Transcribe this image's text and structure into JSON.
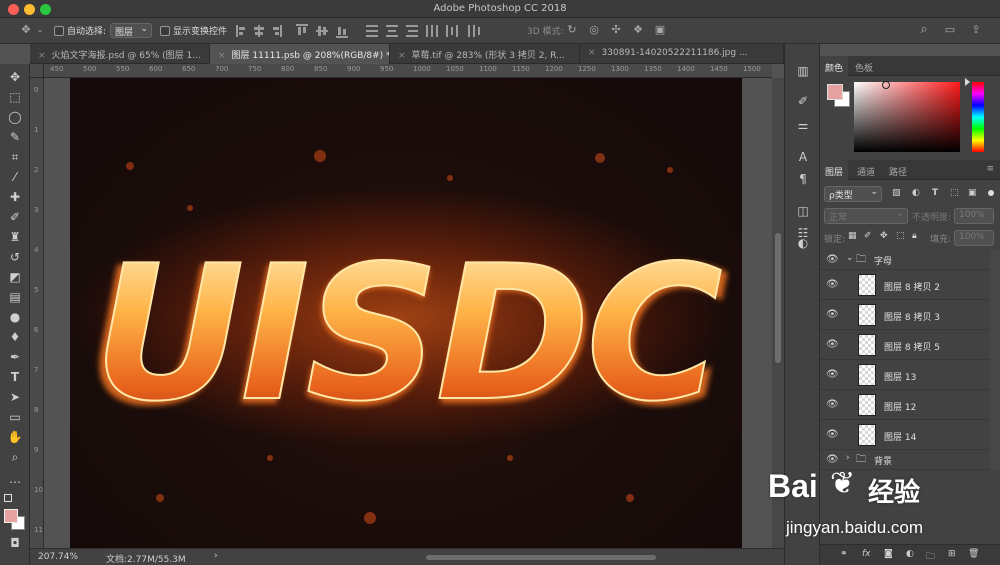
{
  "window": {
    "title": "Adobe Photoshop CC 2018"
  },
  "options_bar": {
    "auto_select_label": "自动选择:",
    "auto_select_value": "图层",
    "show_transform_label": "显示变换控件",
    "mode_3d_label": "3D 模式:"
  },
  "tabs": [
    {
      "label": "火焰文字海报.psd @ 65% (图层 1..."
    },
    {
      "label": "图层 11111.psb @ 208%(RGB/8#) *"
    },
    {
      "label": "草莓.tif @ 283% (形状 3 拷贝 2, R..."
    },
    {
      "label": "330891-14020522211186.jpg ..."
    }
  ],
  "ruler": {
    "horizontal": [
      "450",
      "500",
      "550",
      "600",
      "650",
      "700",
      "750",
      "800",
      "850",
      "900",
      "950",
      "1000",
      "1050",
      "1100",
      "1150",
      "1200",
      "1250",
      "1300",
      "1350",
      "1400",
      "1450",
      "1500"
    ],
    "vertical": [
      "0",
      "1",
      "2",
      "3",
      "4",
      "5",
      "6",
      "7",
      "8",
      "9",
      "10",
      "11"
    ]
  },
  "canvas": {
    "text": "UISDC"
  },
  "status": {
    "zoom": "207.74%",
    "doc": "文档:2.77M/55.3M",
    "arrow": "›"
  },
  "color_panel": {
    "tabs": [
      "颜色",
      "色板"
    ],
    "foreground": "#e4a2a1",
    "background": "#ffffff",
    "hue": "#ff1a1a"
  },
  "layers_panel": {
    "tabs": [
      "图层",
      "通道",
      "路径"
    ],
    "filter_label": "ρ类型",
    "blend_mode": "正常",
    "opacity_label": "不透明度:",
    "opacity_value": "100%",
    "lock_label": "锁定:",
    "fill_label": "填充:",
    "fill_value": "100%",
    "group_label": "字母",
    "layers": [
      {
        "name": "图层 8 拷贝 2"
      },
      {
        "name": "图层 8 拷贝 3"
      },
      {
        "name": "图层 8 拷贝 5"
      },
      {
        "name": "图层 13"
      },
      {
        "name": "图层 12"
      },
      {
        "name": "图层 14"
      }
    ],
    "bg_group_label": "背景"
  },
  "watermark": {
    "brand": "Bai",
    "brand2": "经验",
    "url": "jingyan.baidu.com"
  },
  "icons": [
    "move-icon",
    "marquee-icon",
    "lasso-icon",
    "quick-select-icon",
    "crop-icon",
    "eyedropper-icon",
    "heal-icon",
    "brush-icon",
    "stamp-icon",
    "history-brush-icon",
    "eraser-icon",
    "gradient-icon",
    "blur-icon",
    "dodge-icon",
    "pen-icon",
    "type-icon",
    "path-select-icon",
    "shape-icon",
    "hand-icon",
    "zoom-icon"
  ]
}
